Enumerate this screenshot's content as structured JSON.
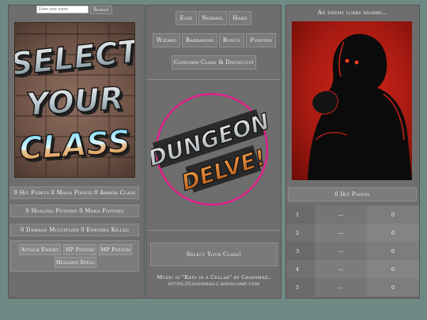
{
  "name_entry": {
    "placeholder": "Enter your name",
    "submit_label": "Submit"
  },
  "class_art": {
    "title_lines": [
      "SELECT",
      "YOUR",
      "CLASS"
    ]
  },
  "player": {
    "stats_line": "0 Hit Points 0 Mana Points 0 Armor Class",
    "potions_line": "0 Healing Potions 0 Mana Potions",
    "combat_line": "0 Damage Multiplier 0 Enemies Killed"
  },
  "actions": {
    "attack_label": "Attack Enemy",
    "hp_potion_label": "HP Potion",
    "mp_potion_label": "MP Potion",
    "heal_label": "Healing Spell"
  },
  "difficulty": {
    "easy": "Easy",
    "normal": "Normal",
    "hard": "Hard"
  },
  "classes": {
    "wizard": "Wizard",
    "barbarian": "Barbarian",
    "rogue": "Rogue",
    "fighter": "Fighter"
  },
  "confirm_label": "Conform Class & Difficulty",
  "logo": {
    "line1": "DUNGEON",
    "line2": "DELVE!"
  },
  "class_message": "Select Your Class!",
  "music_credit": "Music is \"Rats in a Cellar\" by Chainmail. https://chainmailc.bandcamp.com",
  "enemy": {
    "title": "An enemy lurks nearby...",
    "hp_text": "0 Hit Points",
    "rows": [
      {
        "num": "1",
        "mid": "---",
        "val": "0"
      },
      {
        "num": "2",
        "mid": "---",
        "val": "0"
      },
      {
        "num": "3",
        "mid": "---",
        "val": "0"
      },
      {
        "num": "4",
        "mid": "---",
        "val": "0"
      },
      {
        "num": "5",
        "mid": "---",
        "val": "0"
      }
    ]
  },
  "colors": {
    "background": "#6f8a84",
    "panel": "#6e6e6e",
    "enemy_red": "#c8221a",
    "logo_ring": "#e0208a",
    "logo_orange": "#d8782a"
  }
}
